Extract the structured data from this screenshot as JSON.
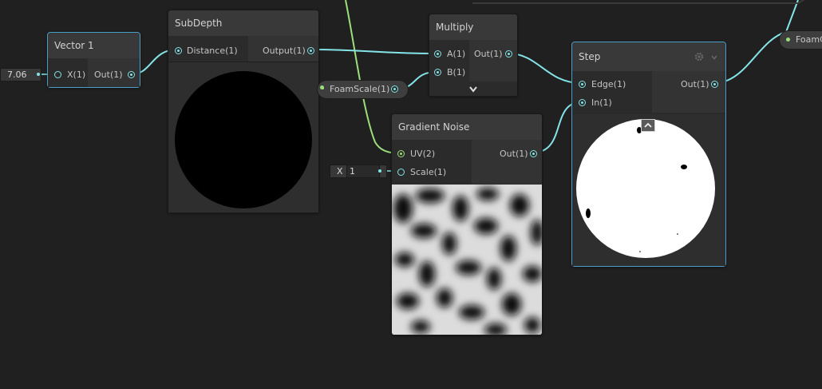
{
  "nodes": {
    "vector1": {
      "title": "Vector 1",
      "input_label": "X(1)",
      "output_label": "Out(1)",
      "value": "7.06"
    },
    "subdepth": {
      "title": "SubDepth",
      "input_label": "Distance(1)",
      "output_label": "Output(1)"
    },
    "multiply": {
      "title": "Multiply",
      "input_a": "A(1)",
      "input_b": "B(1)",
      "output_label": "Out(1)"
    },
    "foamscale": {
      "label": "FoamScale(1)"
    },
    "gradient_noise": {
      "title": "Gradient Noise",
      "input_uv": "UV(2)",
      "input_scale": "Scale(1)",
      "output_label": "Out(1)",
      "scale_axis": "X",
      "scale_value": "1"
    },
    "step": {
      "title": "Step",
      "input_edge": "Edge(1)",
      "input_in": "In(1)",
      "output_label": "Out(1)"
    },
    "foam_prop": {
      "label": "FoamC"
    }
  },
  "colors": {
    "wire_float": "#84e4e7",
    "wire_vec2": "#9cdf7a",
    "selected_border": "#4a9fc9",
    "background": "#202020"
  },
  "icons": {
    "gear": "gear-icon",
    "collapse": "chevron-down-icon",
    "preview_toggle": "chevron-up-icon"
  }
}
